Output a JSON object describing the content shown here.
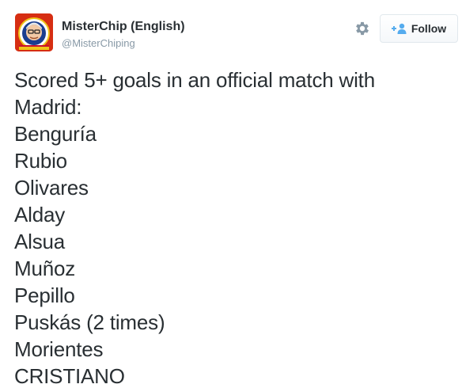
{
  "header": {
    "display_name": "MisterChip (English)",
    "handle": "@MisterChiping",
    "avatar_icon": "misterchip-avatar-icon",
    "settings_icon": "gear-icon",
    "follow_button": {
      "label": "Follow",
      "icon": "add-user-icon"
    }
  },
  "tweet": {
    "lines": [
      "Scored 5+ goals in an official match with",
      "Madrid:",
      "Benguría",
      "Rubio",
      "Olivares",
      "Alday",
      "Alsua",
      "Muñoz",
      "Pepillo",
      "Puskás (2 times)",
      "Morientes",
      "CRISTIANO"
    ]
  },
  "colors": {
    "text": "#292f33",
    "muted": "#8899a6",
    "follow_icon_blue": "#55acee",
    "border": "#e1e8ed"
  }
}
